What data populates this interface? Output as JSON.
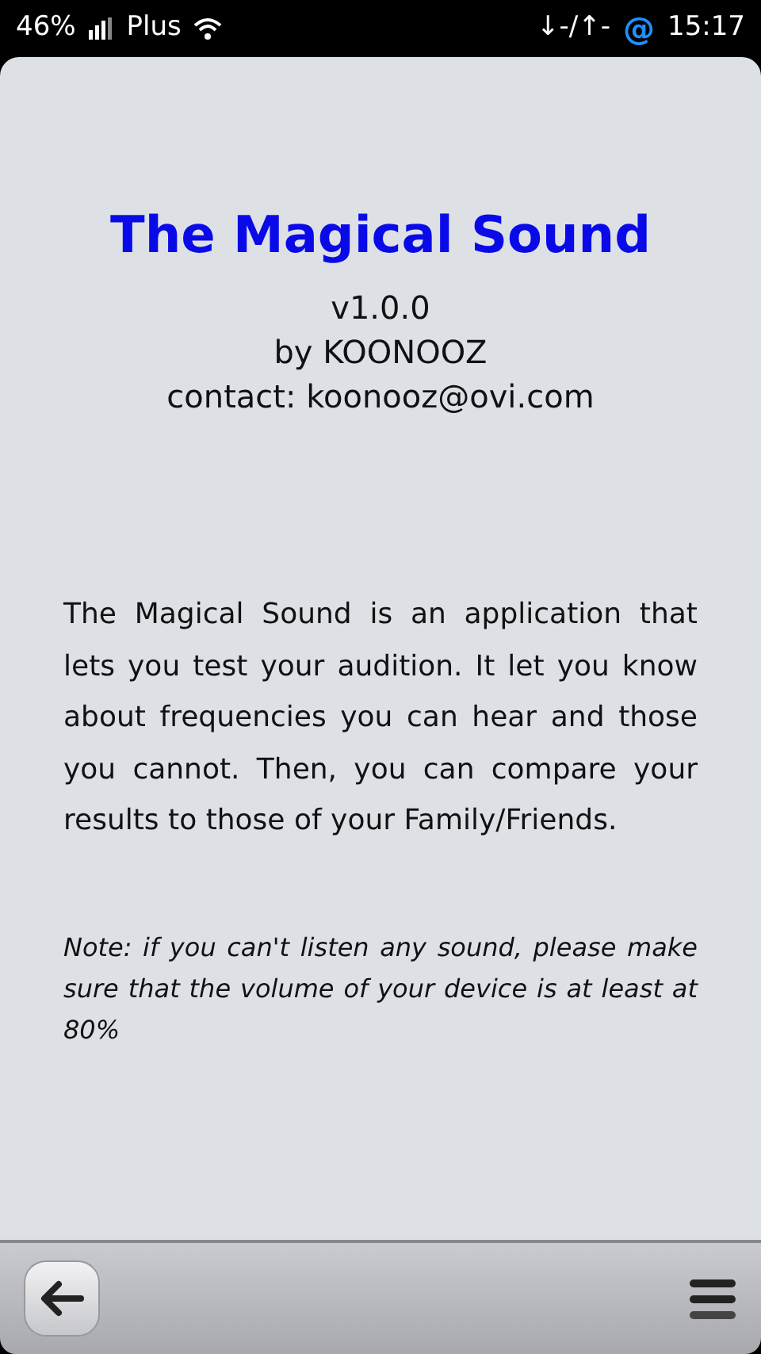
{
  "status_bar": {
    "battery": "46%",
    "operator": "Plus",
    "data_traffic": "↓-/↑-",
    "notification": "@",
    "time": "15:17"
  },
  "about": {
    "title": "The Magical Sound",
    "version": "v1.0.0",
    "author": "by KOONOOZ",
    "contact": "contact: koonooz@ovi.com",
    "description": "The Magical Sound is an application that lets you test your audition. It let you know about frequencies you can hear and those you cannot. Then, you can compare your results to those of your Family/Friends.",
    "note": "Note: if you can't listen any sound, please make sure that the volume of your device is at least at 80%"
  }
}
